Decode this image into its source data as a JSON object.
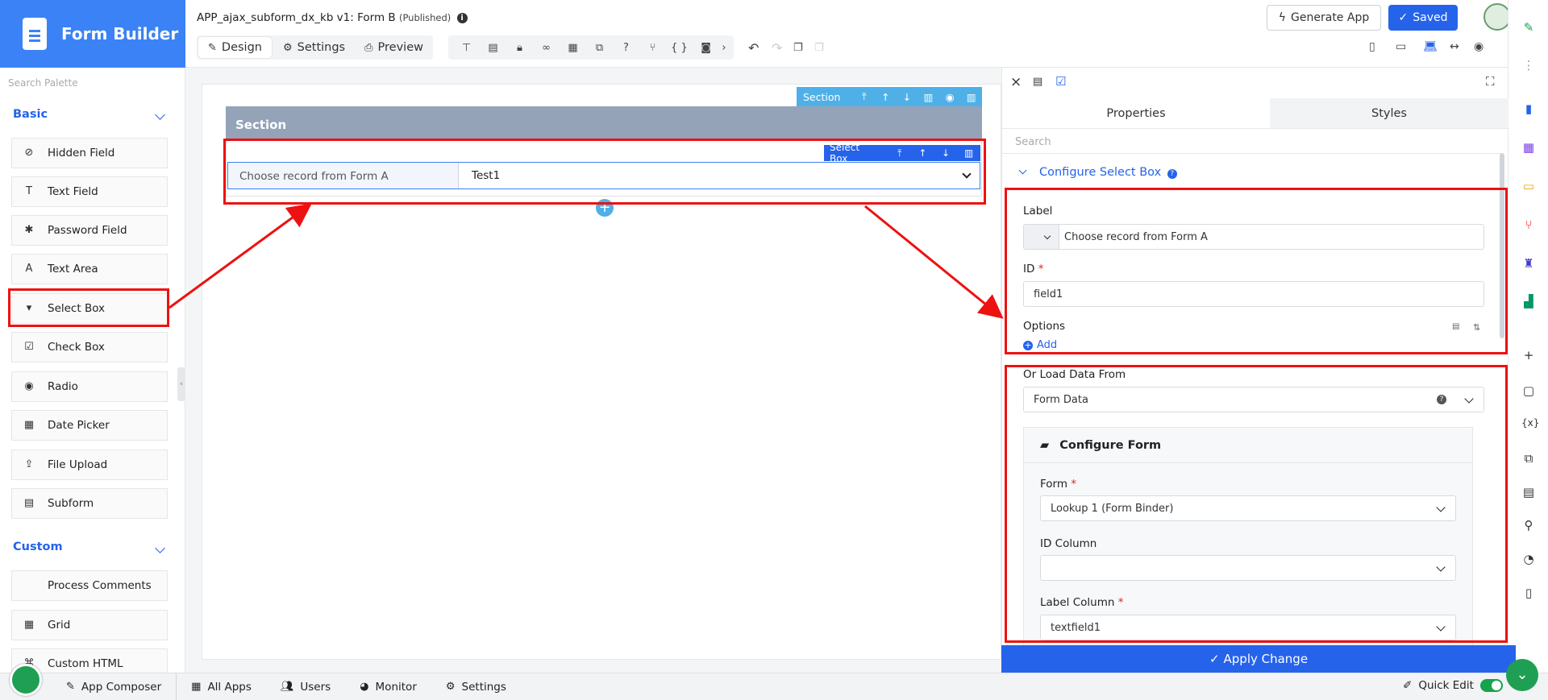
{
  "brand": {
    "title": "Form Builder"
  },
  "header": {
    "app_title": "APP_ajax_subform_dx_kb v1: Form B",
    "status": "(Published)",
    "tabs": [
      {
        "label": "Design",
        "icon": "design-icon"
      },
      {
        "label": "Settings",
        "icon": "gear-icon"
      },
      {
        "label": "Preview",
        "icon": "preview-icon"
      }
    ],
    "generate_label": "Generate App",
    "saved_label": "Saved"
  },
  "palette": {
    "search_placeholder": "Search Palette",
    "basic_label": "Basic",
    "basic_items": [
      "Hidden Field",
      "Text Field",
      "Password Field",
      "Text Area",
      "Select Box",
      "Check Box",
      "Radio",
      "Date Picker",
      "File Upload",
      "Subform"
    ],
    "custom_label": "Custom",
    "custom_items": [
      "Process Comments",
      "Grid",
      "Custom HTML"
    ]
  },
  "canvas": {
    "section_tool_label": "Section",
    "section_title": "Section",
    "selectbox_tool_label": "Select Box",
    "field_label": "Choose record from Form A",
    "field_value": "Test1"
  },
  "properties": {
    "tab_properties": "Properties",
    "tab_styles": "Styles",
    "search_placeholder": "Search",
    "config_title": "Configure Select Box",
    "label_label": "Label",
    "label_value": "Choose record from Form A",
    "id_label": "ID",
    "id_value": "field1",
    "options_label": "Options",
    "add_label": "Add",
    "load_from_label": "Or Load Data From",
    "load_from_value": "Form Data",
    "configure_form_title": "Configure Form",
    "form_label": "Form",
    "form_value": "Lookup 1 (Form Binder)",
    "id_column_label": "ID Column",
    "id_column_value": "",
    "label_column_label": "Label Column",
    "label_column_value": "textfield1",
    "required_mark": "*",
    "apply_label": "Apply Change"
  },
  "bottombar": {
    "items": [
      "App Composer",
      "All Apps",
      "Users",
      "Monitor",
      "Settings"
    ],
    "quick_edit_label": "Quick Edit"
  },
  "colors": {
    "accent": "#2563eb",
    "brand": "#3b82f6",
    "section": "#94a3b8",
    "annotation": "#e11111",
    "green": "#1f9f53"
  }
}
